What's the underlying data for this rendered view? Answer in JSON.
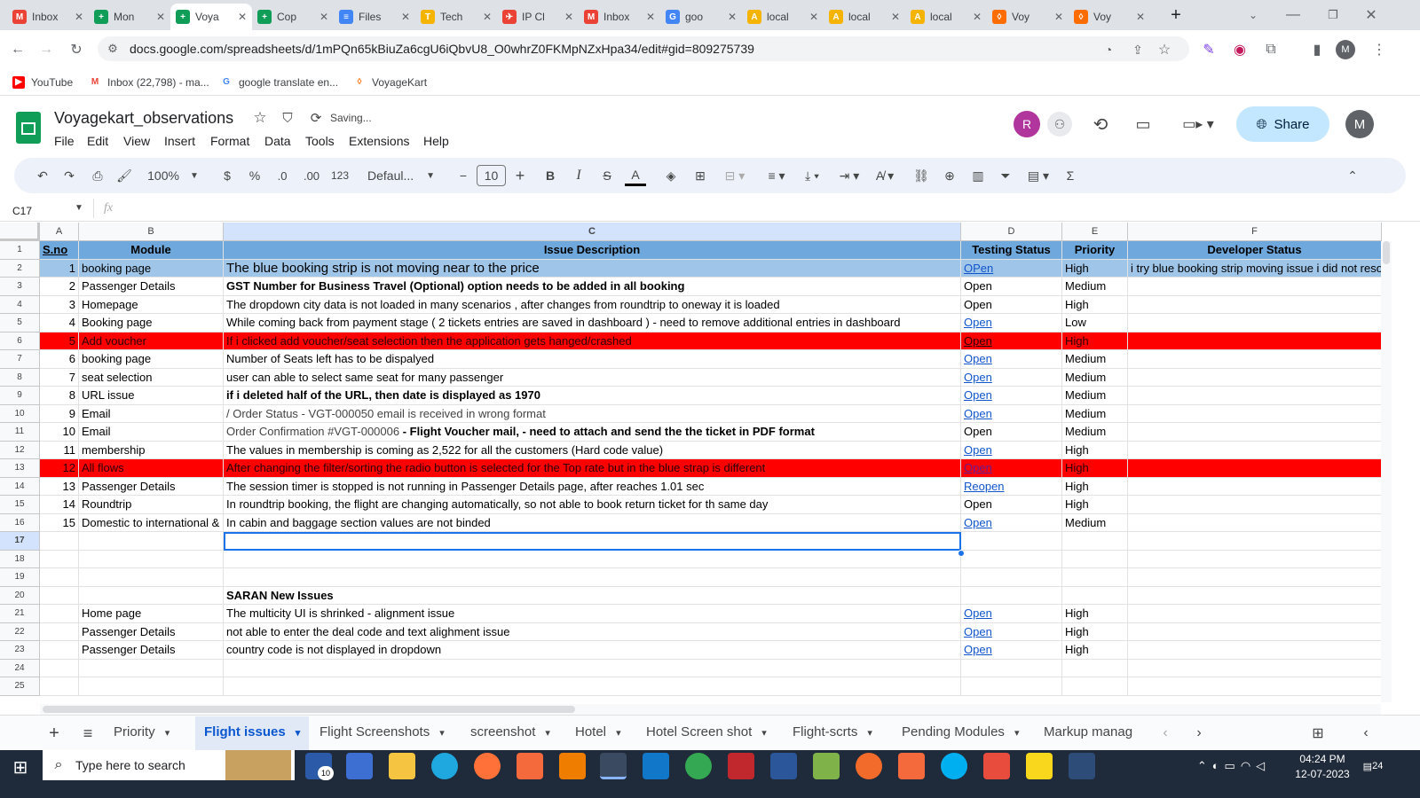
{
  "browser_tabs": [
    {
      "title": "Inbox",
      "fav": "M",
      "color": "#ea4335"
    },
    {
      "title": "Mon",
      "fav": "+",
      "color": "#0f9d58"
    },
    {
      "title": "Voya",
      "fav": "+",
      "color": "#0f9d58",
      "active": true
    },
    {
      "title": "Cop",
      "fav": "+",
      "color": "#0f9d58"
    },
    {
      "title": "Files",
      "fav": "≡",
      "color": "#4285f4"
    },
    {
      "title": "Tech",
      "fav": "T",
      "color": "#f4b400"
    },
    {
      "title": "IP Cl",
      "fav": "✈",
      "color": "#ea4335"
    },
    {
      "title": "Inbox",
      "fav": "M",
      "color": "#ea4335"
    },
    {
      "title": "goo",
      "fav": "G",
      "color": "#4285f4"
    },
    {
      "title": "local",
      "fav": "A",
      "color": "#f4b400"
    },
    {
      "title": "local",
      "fav": "A",
      "color": "#f4b400"
    },
    {
      "title": "local",
      "fav": "A",
      "color": "#f4b400"
    },
    {
      "title": "Voy",
      "fav": "◊",
      "color": "#ff6d00"
    },
    {
      "title": "Voy",
      "fav": "◊",
      "color": "#ff6d00"
    }
  ],
  "url": "docs.google.com/spreadsheets/d/1mPQn65kBiuZa6cgU6iQbvU8_O0whrZ0FKMpNZxHpa34/edit#gid=809275739",
  "bookmarks": [
    "YouTube",
    "Inbox (22,798) - ma...",
    "google translate en...",
    "VoyageKart"
  ],
  "doc": {
    "title": "Voyagekart_observations",
    "status": "Saving...",
    "share": "Share",
    "avatar_r": "R",
    "avatar_m": "M"
  },
  "menu": [
    "File",
    "Edit",
    "View",
    "Insert",
    "Format",
    "Data",
    "Tools",
    "Extensions",
    "Help"
  ],
  "toolbar": {
    "zoom": "100%",
    "currency": "$",
    "percent": "%",
    "dec_less": ".0",
    "dec_more": ".00",
    "num_fmt": "123",
    "font": "Defaul...",
    "size": "10"
  },
  "namebox": "C17",
  "fx": "fx",
  "columns": [
    "A",
    "B",
    "C",
    "D",
    "E",
    "F"
  ],
  "rows": [
    {
      "n": "1",
      "a": "S.no",
      "b": "Module",
      "c": "Issue Description",
      "d": "Testing Status",
      "e": "Priority",
      "f": "Developer Status"
    },
    {
      "n": "2",
      "a": "1",
      "b": "booking page",
      "c": "The blue booking strip is not moving near to the price",
      "d": "OPen",
      "e": "High",
      "f": "i try blue booking strip moving issue i did not reso"
    },
    {
      "n": "3",
      "a": "2",
      "b": "Passenger Details",
      "c": " GST Number for Business Travel (Optional) option needs to be added in all booking",
      "d": "Open",
      "e": "Medium",
      "f": ""
    },
    {
      "n": "4",
      "a": "3",
      "b": "Homepage",
      "c": "The dropdown city data is not loaded  in many scenarios , after changes from roundtrip to oneway it is loaded",
      "d": "Open",
      "e": "High",
      "f": ""
    },
    {
      "n": "5",
      "a": "4",
      "b": "Booking page",
      "c": " While coming back from payment stage ( 2 tickets entries are saved in dashboard ) - need to remove additional entries  in dashboard",
      "d": "Open",
      "e": "Low",
      "f": ""
    },
    {
      "n": "6",
      "a": "5",
      "b": "Add voucher",
      "c": "If i clicked add voucher/seat selection  then the application gets hanged/crashed",
      "d": "Open",
      "e": "High",
      "f": ""
    },
    {
      "n": "7",
      "a": "6",
      "b": "booking page",
      "c": "Number of Seats  left has to be dispalyed",
      "d": "Open",
      "e": "Medium",
      "f": ""
    },
    {
      "n": "8",
      "a": "7",
      "b": "seat selection",
      "c": "user can able to select same seat for many passenger",
      "d": "Open",
      "e": "Medium",
      "f": ""
    },
    {
      "n": "9",
      "a": "8",
      "b": "URL issue",
      "c": "if i deleted half of  the URL, then date is displayed as 1970",
      "d": "Open",
      "e": "Medium",
      "f": ""
    },
    {
      "n": "10",
      "a": "9",
      "b": "Email",
      "c": " / Order Status - VGT-000050 email is received in wrong format",
      "d": "Open",
      "e": "Medium",
      "f": ""
    },
    {
      "n": "11",
      "a": "10",
      "b": "Email",
      "c": "Order Confirmation #VGT-000006 ",
      "c2": "- Flight Voucher mail,   - need to attach and send the the ticket in PDF format",
      "d": "Open",
      "e": "Medium",
      "f": ""
    },
    {
      "n": "12",
      "a": "11",
      "b": "membership",
      "c": "The values in membership is coming  as  2,522 for all the customers (Hard code value)",
      "d": "Open",
      "e": "High",
      "f": ""
    },
    {
      "n": "13",
      "a": "12",
      "b": "All flows",
      "c": "After changing the filter/sorting the radio button is selected for the Top rate but in the blue strap is different",
      "d": "Open",
      "e": "High",
      "f": ""
    },
    {
      "n": "14",
      "a": "13",
      "b": "Passenger Details",
      "c": "The session timer is stopped is not running  in Passenger Details page, after reaches 1.01 sec",
      "d": "Reopen",
      "e": "High",
      "f": ""
    },
    {
      "n": "15",
      "a": "14",
      "b": "Roundtrip",
      "c": " In roundtrip booking,   the flight are changing automatically,  so not able to book return ticket for th same day",
      "d": "Open",
      "e": "High",
      "f": ""
    },
    {
      "n": "16",
      "a": "15",
      "b": "Domestic to international &",
      "c": "In cabin and  baggage section values are not binded",
      "d": "Open",
      "e": "Medium",
      "f": ""
    },
    {
      "n": "17",
      "a": "",
      "b": "",
      "c": "",
      "d": "",
      "e": "",
      "f": ""
    },
    {
      "n": "18",
      "a": "",
      "b": "",
      "c": "",
      "d": "",
      "e": "",
      "f": ""
    },
    {
      "n": "19",
      "a": "",
      "b": "",
      "c": "",
      "d": "",
      "e": "",
      "f": ""
    },
    {
      "n": "20",
      "a": "",
      "b": "",
      "c": "SARAN New  Issues",
      "d": "",
      "e": "",
      "f": ""
    },
    {
      "n": "21",
      "a": "",
      "b": "Home page",
      "c": "The multicity UI is shrinked  - alignment issue",
      "d": "Open",
      "e": "High",
      "f": ""
    },
    {
      "n": "22",
      "a": "",
      "b": "Passenger Details",
      "c": "not able to enter the deal code and text alighment issue",
      "d": "Open",
      "e": "High",
      "f": ""
    },
    {
      "n": "23",
      "a": "",
      "b": "Passenger Details",
      "c": "country code is not displayed in dropdown",
      "d": "Open",
      "e": "High",
      "f": ""
    },
    {
      "n": "24",
      "a": "",
      "b": "",
      "c": "",
      "d": "",
      "e": "",
      "f": ""
    },
    {
      "n": "25",
      "a": "",
      "b": "",
      "c": "",
      "d": "",
      "e": "",
      "f": ""
    }
  ],
  "sheet_tabs": [
    "Priority",
    "Flight issues",
    "Flight Screenshots",
    "screenshot",
    "Hotel",
    "Hotel Screen shot",
    "Flight-scrts",
    "Pending Modules",
    "Markup manag"
  ],
  "taskbar": {
    "search": "Type here to search",
    "time": "04:24 PM",
    "date": "12-07-2023",
    "notif": "24",
    "badge": "10"
  },
  "colors": {
    "header_blue": "#6fa8dc",
    "row2_blue": "#9fc5e8",
    "red": "#ff0000",
    "link": "#1155cc"
  }
}
